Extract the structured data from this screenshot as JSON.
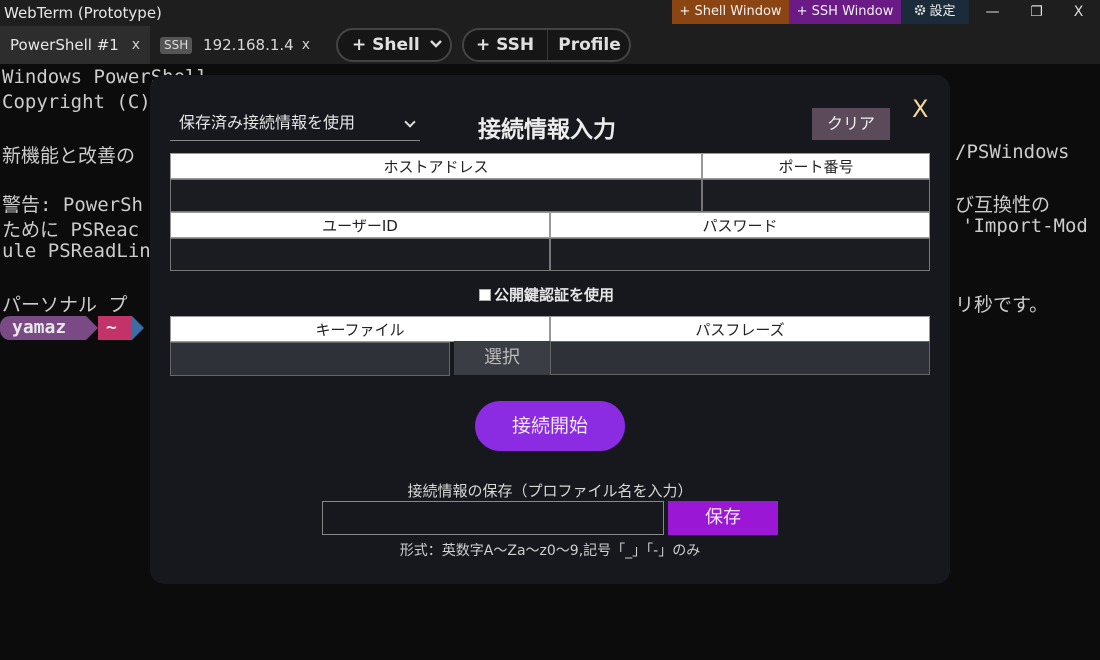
{
  "window": {
    "title": "WebTerm (Prototype)",
    "shell_window_button": "+ Shell Window",
    "ssh_window_button": "+ SSH Window",
    "settings_button": "設定",
    "minimize": "—",
    "maximize": "❐",
    "close": "X"
  },
  "tabs": [
    {
      "label": "PowerShell #1",
      "close": "x"
    },
    {
      "badge": "SSH",
      "label": "192.168.1.4",
      "close": "x"
    }
  ],
  "toolbar": {
    "add_shell": "+ Shell",
    "add_ssh": "+ SSH",
    "profile": "Profile"
  },
  "terminal": {
    "lines": [
      "Windows PowerShell",
      "Copyright (C)",
      "",
      "新機能と改善の",
      "",
      "警告: PowerSh",
      "ために PSReac",
      "ule PSReadLin",
      "",
      "パーソナル プ"
    ],
    "right_fragments": [
      "/PSWindows",
      "び互換性の",
      "'Import-Mod",
      "リ秒です。"
    ],
    "prompt_user": "yamaz",
    "prompt_dir": "~"
  },
  "dialog": {
    "saved_profile_select": "保存済み接続情報を使用",
    "title": "接続情報入力",
    "clear_button": "クリア",
    "close_button": "X",
    "host_label": "ホストアドレス",
    "port_label": "ポート番号",
    "user_label": "ユーザーID",
    "password_label": "パスワード",
    "pubkey_checkbox": "公開鍵認証を使用",
    "keyfile_label": "キーファイル",
    "passphrase_label": "パスフレーズ",
    "select_button": "選択",
    "connect_button": "接続開始",
    "save_title": "接続情報の保存（プロファイル名を入力）",
    "save_button": "保存",
    "format_note": "形式：英数字A〜Za〜z0〜9,記号「_」「-」のみ"
  },
  "colors": {
    "accent": "#8b2be2",
    "save": "#9b17d6",
    "shell_window": "#8a4512",
    "ssh_window": "#6a1b86"
  }
}
